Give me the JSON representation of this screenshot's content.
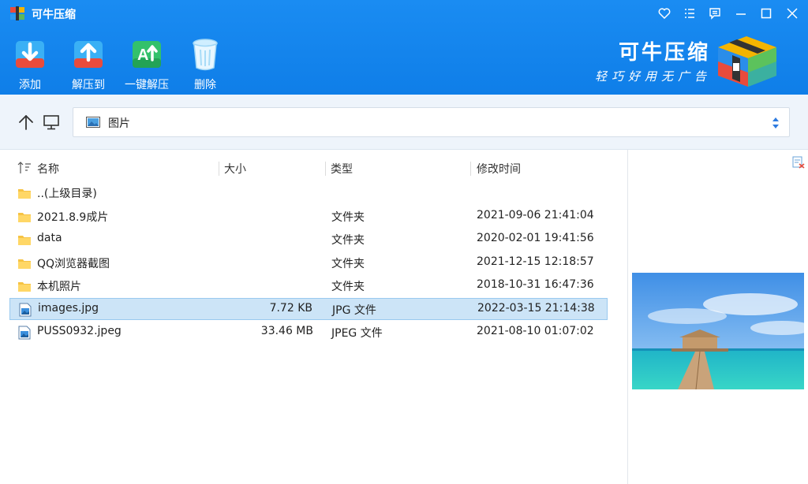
{
  "window": {
    "title": "可牛压缩",
    "controls": [
      "heart-icon",
      "menu-list-icon",
      "feedback-icon",
      "minimize-icon",
      "maximize-icon",
      "close-icon"
    ]
  },
  "toolbar": {
    "add_label": "添加",
    "extract_to_label": "解压到",
    "one_click_extract_label": "一键解压",
    "delete_label": "删除"
  },
  "brand": {
    "name": "可牛压缩",
    "slogan": "轻巧好用无广告"
  },
  "address": {
    "path": "图片"
  },
  "columns": {
    "name": "名称",
    "size": "大小",
    "type": "类型",
    "modified": "修改时间"
  },
  "files": [
    {
      "name": "..(上级目录)",
      "size": "",
      "type": "",
      "modified": "",
      "icon": "folder-icon",
      "selected": false
    },
    {
      "name": "2021.8.9成片",
      "size": "",
      "type": "文件夹",
      "modified": "2021-09-06 21:41:04",
      "icon": "folder-icon",
      "selected": false
    },
    {
      "name": "data",
      "size": "",
      "type": "文件夹",
      "modified": "2020-02-01 19:41:56",
      "icon": "folder-icon",
      "selected": false
    },
    {
      "name": "QQ浏览器截图",
      "size": "",
      "type": "文件夹",
      "modified": "2021-12-15 12:18:57",
      "icon": "folder-icon",
      "selected": false
    },
    {
      "name": "本机照片",
      "size": "",
      "type": "文件夹",
      "modified": "2018-10-31 16:47:36",
      "icon": "folder-icon",
      "selected": false
    },
    {
      "name": "images.jpg",
      "size": "7.72 KB",
      "type": "JPG 文件",
      "modified": "2022-03-15 21:14:38",
      "icon": "image-file-icon",
      "selected": true
    },
    {
      "name": "PUSS0932.jpeg",
      "size": "33.46 MB",
      "type": "JPEG 文件",
      "modified": "2021-08-10 01:07:02",
      "icon": "image-file-icon",
      "selected": false
    }
  ],
  "colors": {
    "header_blue": "#1a8cf2",
    "selection_bg": "#cce4f7",
    "selection_border": "#99c9ef",
    "address_bg": "#eef4fb"
  }
}
